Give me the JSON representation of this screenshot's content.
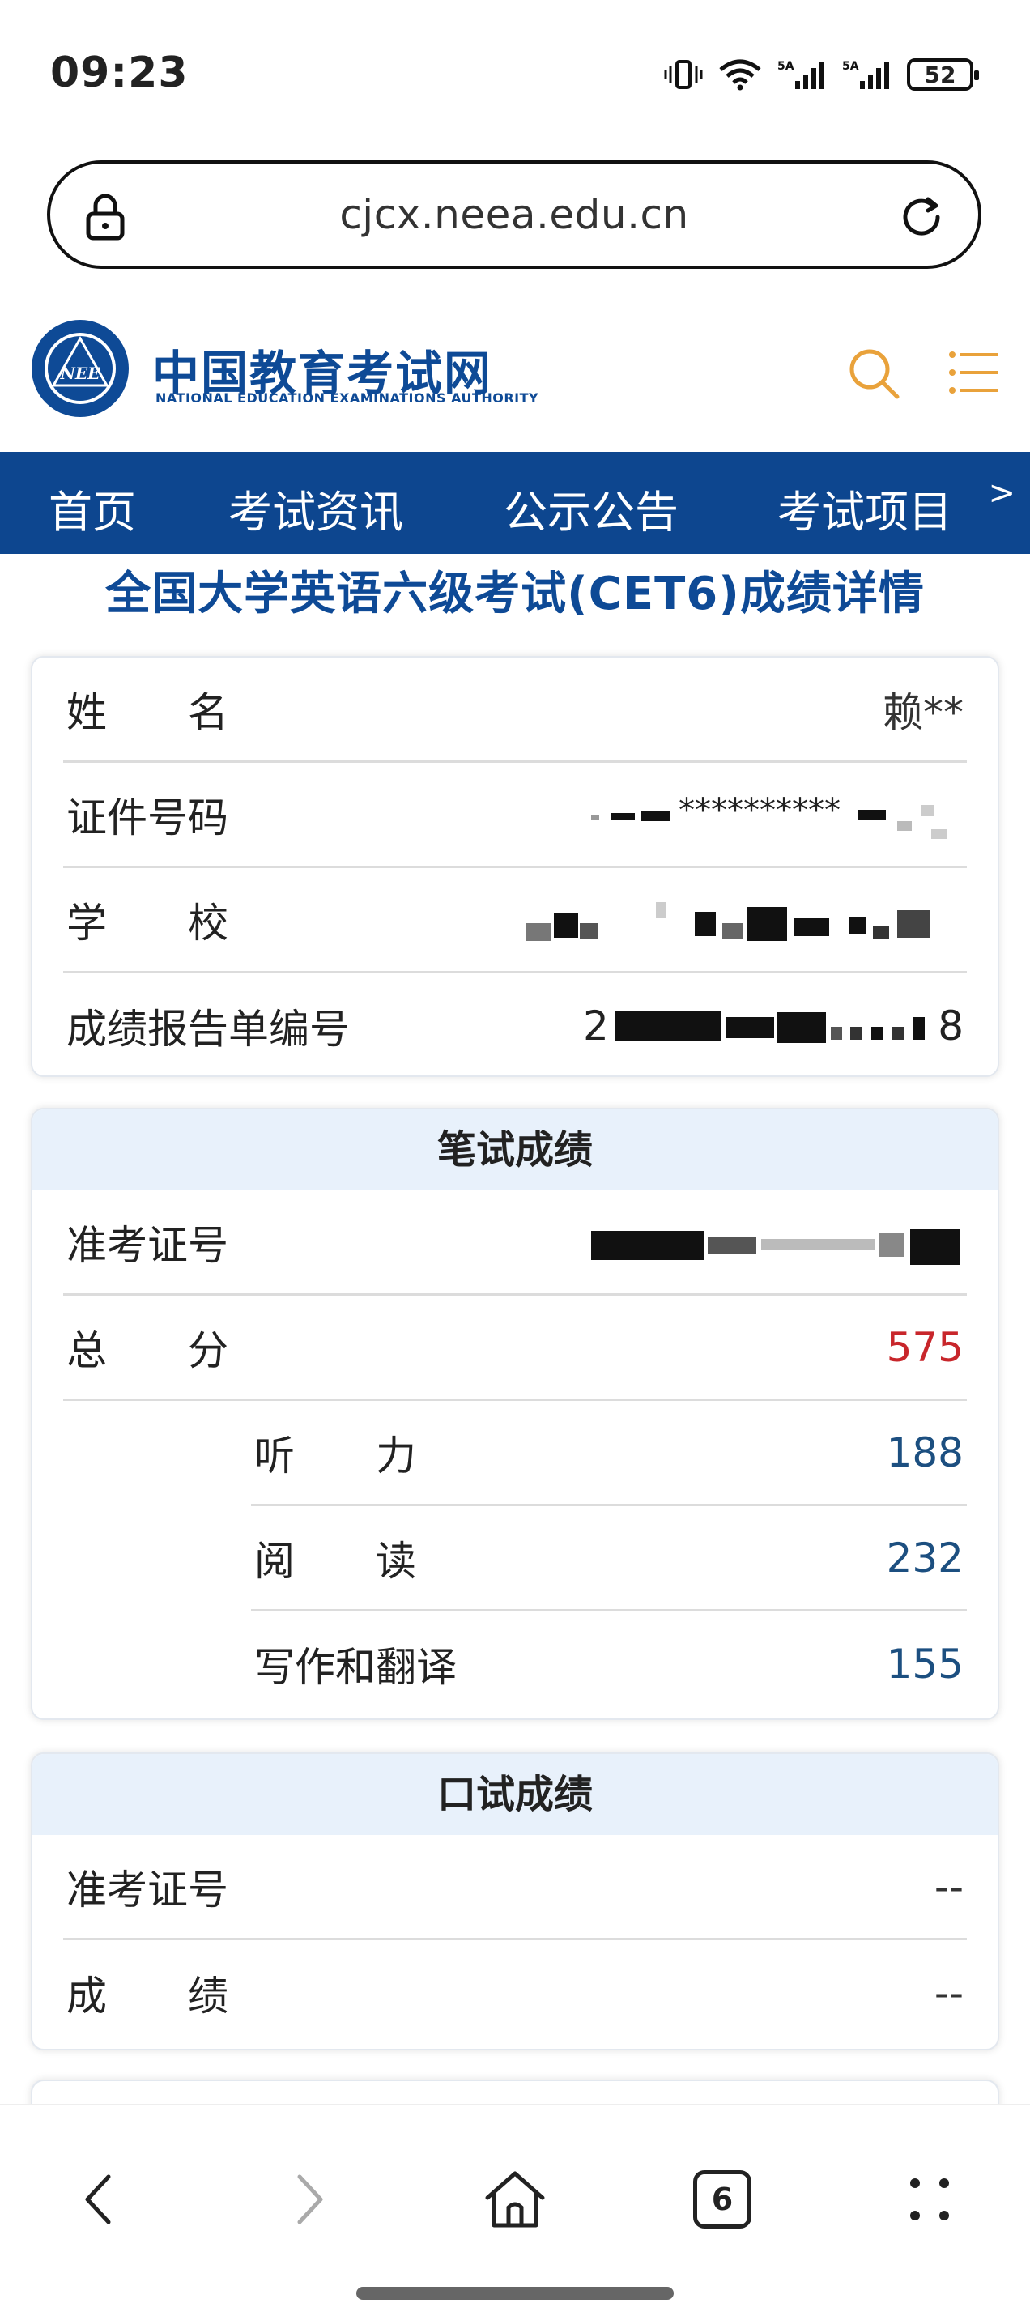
{
  "status_bar": {
    "time": "09:23",
    "battery": "52"
  },
  "browser": {
    "url": "cjcx.neea.edu.cn"
  },
  "site": {
    "emblem_text": "NEE",
    "title": "中国教育考试网",
    "subtitle": "NATIONAL EDUCATION EXAMINATIONS AUTHORITY"
  },
  "nav": {
    "items": [
      "首页",
      "考试资讯",
      "公示公告",
      "考试项目"
    ],
    "more": ">"
  },
  "page_title": "全国大学英语六级考试(CET6)成绩详情",
  "info_card": {
    "name_label": "姓　　名",
    "name_value": "赖**",
    "id_label": "证件号码",
    "id_value": "**********",
    "school_label": "学　　校",
    "report_label": "成绩报告单编号",
    "report_value_start": "2",
    "report_value_end": "8"
  },
  "written_card": {
    "title": "笔试成绩",
    "ticket_label": "准考证号",
    "total_label": "总　　分",
    "total_value": "575",
    "listening_label": "听　　力",
    "listening_value": "188",
    "reading_label": "阅　　读",
    "reading_value": "232",
    "writing_label": "写作和翻译",
    "writing_value": "155"
  },
  "oral_card": {
    "title": "口试成绩",
    "ticket_label": "准考证号",
    "ticket_value": "--",
    "score_label": "成　　绩",
    "score_value": "--"
  },
  "bottom_nav": {
    "tabs_count": "6"
  },
  "colors": {
    "brand_blue": "#0d468f",
    "score_red": "#c8262b",
    "score_blue": "#1c4f80",
    "card_head_bg": "#e8f1fb"
  }
}
